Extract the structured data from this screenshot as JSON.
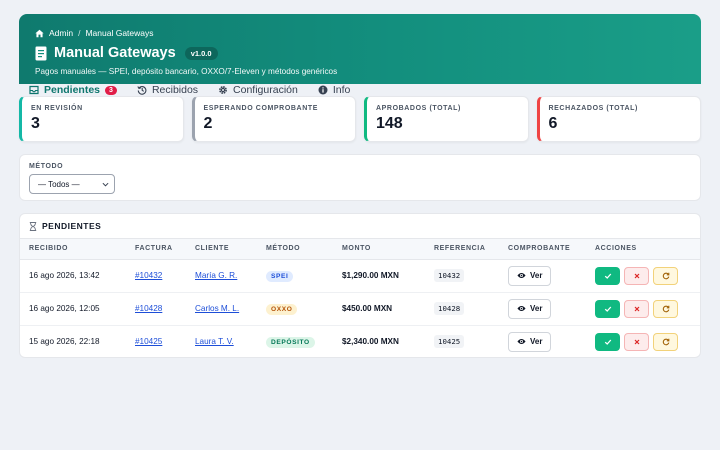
{
  "breadcrumb": {
    "root": "Admin",
    "sep": "/",
    "current": "Manual Gateways"
  },
  "header": {
    "title": "Manual Gateways",
    "version": "v1.0.0",
    "subtitle": "Pagos manuales — SPEI, depósito bancario, OXXO/7-Eleven y métodos genéricos"
  },
  "tabs": [
    {
      "label": "Pendientes",
      "badge": "3",
      "icon": "inbox-icon",
      "active": true
    },
    {
      "label": "Recibidos",
      "icon": "history-icon"
    },
    {
      "label": "Configuración",
      "icon": "gear-icon"
    },
    {
      "label": "Info",
      "icon": "info-icon"
    }
  ],
  "stats": [
    {
      "label": "EN REVISIÓN",
      "value": "3"
    },
    {
      "label": "ESPERANDO COMPROBANTE",
      "value": "2"
    },
    {
      "label": "APROBADOS (TOTAL)",
      "value": "148"
    },
    {
      "label": "RECHAZADOS (TOTAL)",
      "value": "6"
    }
  ],
  "filter": {
    "label": "MÉTODO",
    "selected": "— Todos —"
  },
  "pending": {
    "title": "PENDIENTES",
    "columns": [
      "RECIBIDO",
      "FACTURA",
      "CLIENTE",
      "MÉTODO",
      "MONTO",
      "REFERENCIA",
      "COMPROBANTE",
      "ACCIONES"
    ],
    "view_label": "Ver",
    "rows": [
      {
        "received": "16 ago 2026, 13:42",
        "invoice": "#10432",
        "client": "María G. R.",
        "method": "SPEI",
        "amount": "$1,290.00 MXN",
        "reference": "10432"
      },
      {
        "received": "16 ago 2026, 12:05",
        "invoice": "#10428",
        "client": "Carlos M. L.",
        "method": "OXXO",
        "amount": "$450.00 MXN",
        "reference": "10428"
      },
      {
        "received": "15 ago 2026, 22:18",
        "invoice": "#10425",
        "client": "Laura T. V.",
        "method": "DEPÓSITO",
        "amount": "$2,340.00 MXN",
        "reference": "10425"
      }
    ]
  },
  "colors": {
    "header_start": "#0f7a6e",
    "header_end": "#1a9e88",
    "spei": "#1d4ed8",
    "oxxo": "#b45309",
    "deposito": "#047857",
    "approve": "#10b981",
    "reject": "#dc2626",
    "revert": "#a16207"
  }
}
